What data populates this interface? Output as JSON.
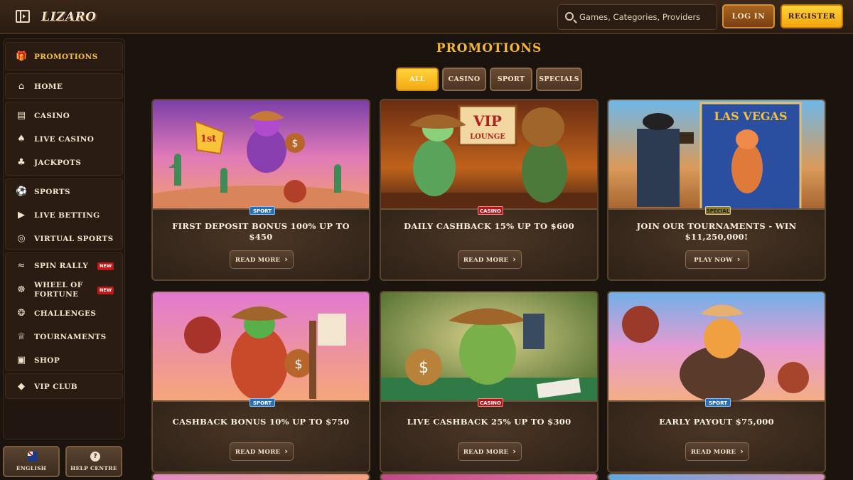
{
  "header": {
    "logo_text": "LIZARO",
    "search_placeholder": "Games, Categories, Providers",
    "login_label": "LOG IN",
    "register_label": "REGISTER"
  },
  "sidebar": {
    "items": [
      {
        "label": "PROMOTIONS",
        "icon": "gift-icon",
        "active": true
      },
      {
        "label": "HOME",
        "icon": "home-icon"
      },
      {
        "label": "CASINO",
        "icon": "slot-machine-icon"
      },
      {
        "label": "LIVE CASINO",
        "icon": "cards-icon"
      },
      {
        "label": "JACKPOTS",
        "icon": "clover-icon"
      },
      {
        "label": "SPORTS",
        "icon": "soccer-ball-icon"
      },
      {
        "label": "LIVE BETTING",
        "icon": "play-icon"
      },
      {
        "label": "VIRTUAL SPORTS",
        "icon": "virtual-icon"
      },
      {
        "label": "SPIN RALLY",
        "icon": "rally-icon",
        "badge": "NEW"
      },
      {
        "label": "WHEEL OF",
        "label2": "FORTUNE",
        "icon": "wheel-icon",
        "badge": "NEW"
      },
      {
        "label": "CHALLENGES",
        "icon": "medal-icon"
      },
      {
        "label": "TOURNAMENTS",
        "icon": "trophy-icon"
      },
      {
        "label": "SHOP",
        "icon": "shopping-bag-icon"
      },
      {
        "label": "VIP CLUB",
        "icon": "diamond-icon"
      }
    ],
    "language_label": "ENGLISH",
    "help_label": "HELP CENTRE"
  },
  "main": {
    "title": "PROMOTIONS",
    "filters": [
      {
        "label": "ALL",
        "active": true
      },
      {
        "label": "CASINO"
      },
      {
        "label": "SPORT"
      },
      {
        "label": "SPECIALS"
      }
    ],
    "cards": [
      {
        "tag": "SPORT",
        "tag_type": "sport",
        "title": "FIRST DEPOSIT BONUS 100% UP TO $450",
        "button": "READ MORE"
      },
      {
        "tag": "CASINO",
        "tag_type": "casino",
        "title": "DAILY CASHBACK 15% UP TO $600",
        "button": "READ MORE"
      },
      {
        "tag": "SPECIAL",
        "tag_type": "special",
        "title": "JOIN OUR TOURNAMENTS - WIN $11,250,000!",
        "button": "PLAY NOW"
      },
      {
        "tag": "SPORT",
        "tag_type": "sport",
        "title": "CASHBACK BONUS 10% UP TO $750",
        "button": "READ MORE"
      },
      {
        "tag": "CASINO",
        "tag_type": "casino",
        "title": "LIVE CASHBACK 25% UP TO $300",
        "button": "READ MORE"
      },
      {
        "tag": "SPORT",
        "tag_type": "sport",
        "title": "EARLY PAYOUT $75,000",
        "button": "READ MORE"
      }
    ],
    "card_art_text": {
      "c1_sign": "1st",
      "c2_sign1": "VIP",
      "c2_sign2": "LOUNGE",
      "c3_sign": "LAS VEGAS"
    }
  },
  "colors": {
    "accent_gold": "#f4b734",
    "background": "#1b130d",
    "panel": "#2a1c12",
    "tag_sport": "#2a6fb8",
    "tag_casino": "#b3161b"
  }
}
